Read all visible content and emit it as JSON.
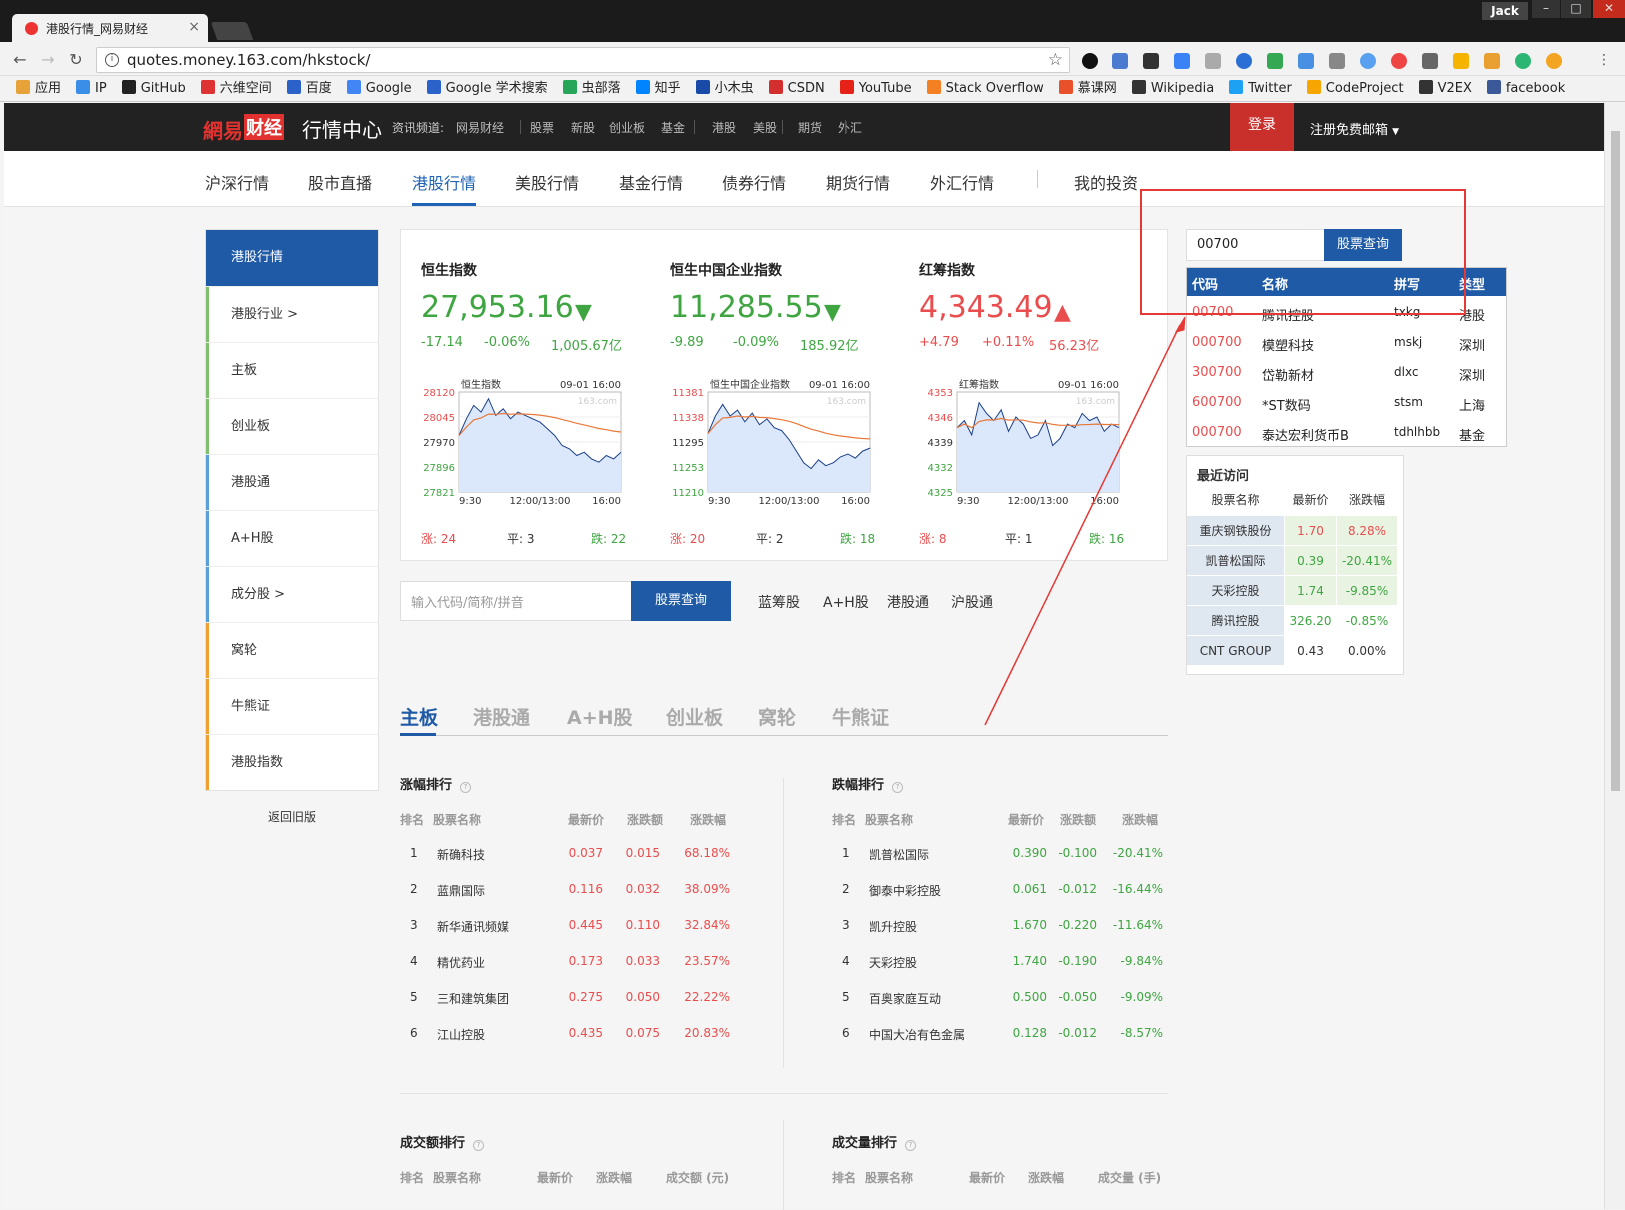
{
  "browser": {
    "tab_title": "港股行情_网易财经",
    "user": "Jack",
    "url": "quotes.money.163.com/hkstock/",
    "bookmarks": [
      "应用",
      "IP",
      "GitHub",
      "六维空间",
      "百度",
      "Google",
      "Google 学术搜索",
      "虫部落",
      "知乎",
      "小木虫",
      "CSDN",
      "YouTube",
      "Stack Overflow",
      "慕课网",
      "Wikipedia",
      "Twitter",
      "CodeProject",
      "V2EX",
      "facebook"
    ],
    "bookmark_colors": [
      "#e8a23a",
      "#3a8ee8",
      "#222222",
      "#d33",
      "#2a62c9",
      "#4285f4",
      "#2a62c9",
      "#27a65a",
      "#0084ff",
      "#1a4aa8",
      "#d32f2f",
      "#e62117",
      "#f48024",
      "#e8512a",
      "#333333",
      "#1da1f2",
      "#f7a600",
      "#333333",
      "#3b5998"
    ]
  },
  "site": {
    "logo_a": "網易",
    "logo_b": "财经",
    "center": "行情中心",
    "channel_label": "资讯频道:",
    "channel_links": [
      "网易财经",
      "股票",
      "新股",
      "创业板",
      "基金",
      "港股",
      "美股",
      "期货",
      "外汇"
    ],
    "login": "登录",
    "register": "注册免费邮箱"
  },
  "main_nav": [
    "沪深行情",
    "股市直播",
    "港股行情",
    "美股行情",
    "基金行情",
    "债券行情",
    "期货行情",
    "外汇行情",
    "我的投资"
  ],
  "sidebar": [
    "港股行情",
    "港股行业 >",
    "主板",
    "创业板",
    "港股通",
    "A+H股",
    "成分股 >",
    "窝轮",
    "牛熊证",
    "港股指数"
  ],
  "sidebar_old": "返回旧版",
  "indices": [
    {
      "name": "恒生指数",
      "value": "27,953.16",
      "dir": "down",
      "change": "-17.14",
      "pct": "-0.06%",
      "amount": "1,005.67亿",
      "chart_title": "恒生指数",
      "chart_time": "09-01 16:00",
      "yticks": [
        "28120",
        "28045",
        "27970",
        "27896",
        "27821"
      ],
      "xticks": [
        "9:30",
        "12:00/13:00",
        "16:00"
      ],
      "up_label": "涨: 24",
      "flat_label": "平: 3",
      "down_label": "跌: 22"
    },
    {
      "name": "恒生中国企业指数",
      "value": "11,285.55",
      "dir": "down",
      "change": "-9.89",
      "pct": "-0.09%",
      "amount": "185.92亿",
      "chart_title": "恒生中国企业指数",
      "chart_time": "09-01 16:00",
      "yticks": [
        "11381",
        "11338",
        "11295",
        "11253",
        "11210"
      ],
      "xticks": [
        "9:30",
        "12:00/13:00",
        "16:00"
      ],
      "up_label": "涨: 20",
      "flat_label": "平: 2",
      "down_label": "跌: 18"
    },
    {
      "name": "红筹指数",
      "value": "4,343.49",
      "dir": "up",
      "change": "+4.79",
      "pct": "+0.11%",
      "amount": "56.23亿",
      "chart_title": "红筹指数",
      "chart_time": "09-01 16:00",
      "yticks": [
        "4353",
        "4346",
        "4339",
        "4332",
        "4325"
      ],
      "xticks": [
        "9:30",
        "12:00/13:00",
        "16:00"
      ],
      "up_label": "涨: 8",
      "flat_label": "平: 1",
      "down_label": "跌: 16"
    }
  ],
  "chart_watermark": "163.com",
  "search": {
    "placeholder": "输入代码/简称/拼音",
    "button": "股票查询",
    "links": [
      "蓝筹股",
      "A+H股",
      "港股通",
      "沪股通"
    ]
  },
  "board_tabs": [
    "主板",
    "港股通",
    "A+H股",
    "创业板",
    "窝轮",
    "牛熊证"
  ],
  "gainers": {
    "title": "涨幅排行",
    "headers": [
      "排名",
      "股票名称",
      "最新价",
      "涨跌额",
      "涨跌幅"
    ],
    "rows": [
      [
        "1",
        "新确科技",
        "0.037",
        "0.015",
        "68.18%"
      ],
      [
        "2",
        "蓝鼎国际",
        "0.116",
        "0.032",
        "38.09%"
      ],
      [
        "3",
        "新华通讯频媒",
        "0.445",
        "0.110",
        "32.84%"
      ],
      [
        "4",
        "精优药业",
        "0.173",
        "0.033",
        "23.57%"
      ],
      [
        "5",
        "三和建筑集团",
        "0.275",
        "0.050",
        "22.22%"
      ],
      [
        "6",
        "江山控股",
        "0.435",
        "0.075",
        "20.83%"
      ]
    ]
  },
  "losers": {
    "title": "跌幅排行",
    "headers": [
      "排名",
      "股票名称",
      "最新价",
      "涨跌额",
      "涨跌幅"
    ],
    "rows": [
      [
        "1",
        "凯普松国际",
        "0.390",
        "-0.100",
        "-20.41%"
      ],
      [
        "2",
        "御泰中彩控股",
        "0.061",
        "-0.012",
        "-16.44%"
      ],
      [
        "3",
        "凯升控股",
        "1.670",
        "-0.220",
        "-11.64%"
      ],
      [
        "4",
        "天彩控股",
        "1.740",
        "-0.190",
        "-9.84%"
      ],
      [
        "5",
        "百奥家庭互动",
        "0.500",
        "-0.050",
        "-9.09%"
      ],
      [
        "6",
        "中国大冶有色金属",
        "0.128",
        "-0.012",
        "-8.57%"
      ]
    ]
  },
  "turnover": {
    "title": "成交额排行",
    "headers": [
      "排名",
      "股票名称",
      "最新价",
      "涨跌幅",
      "成交额 (元)"
    ]
  },
  "volume": {
    "title": "成交量排行",
    "headers": [
      "排名",
      "股票名称",
      "最新价",
      "涨跌幅",
      "成交量 (手)"
    ]
  },
  "quick_search": {
    "value": "00700",
    "button": "股票查询",
    "headers": [
      "代码",
      "名称",
      "拼写",
      "类型"
    ],
    "rows": [
      {
        "code_hl": "00700",
        "code_rest": "",
        "name": "腾讯控股",
        "spell": "txkg",
        "type": "港股"
      },
      {
        "code_hl": "0",
        "code_rest": "00700",
        "name": "模塑科技",
        "spell": "mskj",
        "type": "深圳"
      },
      {
        "code_hl": "3",
        "code_rest": "00700",
        "name": "岱勒新材",
        "spell": "dlxc",
        "type": "深圳"
      },
      {
        "code_hl": "6",
        "code_rest": "00700",
        "name": "*ST数码",
        "spell": "stsm",
        "type": "上海"
      },
      {
        "code_hl": "0",
        "code_rest": "00700",
        "name": "泰达宏利货币B",
        "spell": "tdhlhbb",
        "type": "基金"
      }
    ]
  },
  "recent": {
    "title": "最近访问",
    "headers": [
      "股票名称",
      "最新价",
      "涨跌幅"
    ],
    "rows": [
      [
        "重庆钢铁股份",
        "1.70",
        "8.28%"
      ],
      [
        "凯普松国际",
        "0.39",
        "-20.41%"
      ],
      [
        "天彩控股",
        "1.74",
        "-9.85%"
      ],
      [
        "腾讯控股",
        "326.20",
        "-0.85%"
      ],
      [
        "CNT GROUP",
        "0.43",
        "0.00%"
      ]
    ]
  },
  "colors": {
    "up": "#e94d4d",
    "down": "#3ea541",
    "brand": "#1e5aa6",
    "annotation": "#e53935"
  }
}
